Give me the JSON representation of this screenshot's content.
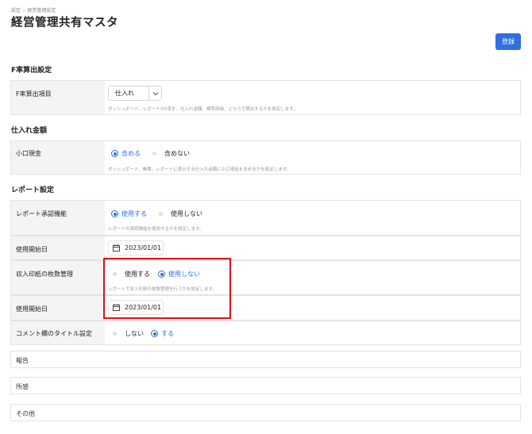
{
  "breadcrumb": [
    "設定",
    "経営管理設定"
  ],
  "breadcrumb_sep": "›",
  "page_title": "経営管理共有マスタ",
  "register_label": "登録",
  "sections": {
    "f_rate": {
      "title": "F率算出設定",
      "item_label": "F率算出項目",
      "select_value": "仕入れ",
      "help": "ダッシュボード、レポートのF率を、仕入れ金額、標準原価、どちらで算出するかを設定します。"
    },
    "purchase": {
      "title": "仕入れ金額",
      "petty_label": "小口現金",
      "opt_include": "含める",
      "opt_exclude": "含めない",
      "help": "ダッシュボード、帳票、レポートに表示する仕入れ金額に小口現金を含めるかを設定します。"
    },
    "report": {
      "title": "レポート設定",
      "approval_label": "レポート承認機能",
      "approval_use": "使用する",
      "approval_nouse": "使用しない",
      "approval_help": "レポートの承認機能を使用するかを設定します。",
      "start_label": "使用開始日",
      "start_date": "2023/01/01",
      "stamp_label": "収入印紙の枚数管理",
      "stamp_use": "使用する",
      "stamp_nouse": "使用しない",
      "stamp_help": "レポートで収入印紙の枚数管理を行うかを設定します。",
      "start2_label": "使用開始日",
      "start2_date": "2023/01/01",
      "comment_label": "コメント欄のタイトル設定",
      "comment_no": "しない",
      "comment_yes": "する",
      "titles": [
        "報告",
        "所感",
        "その他"
      ]
    }
  },
  "colors": {
    "accent": "#2f6fe0",
    "highlight": "#e01010"
  }
}
